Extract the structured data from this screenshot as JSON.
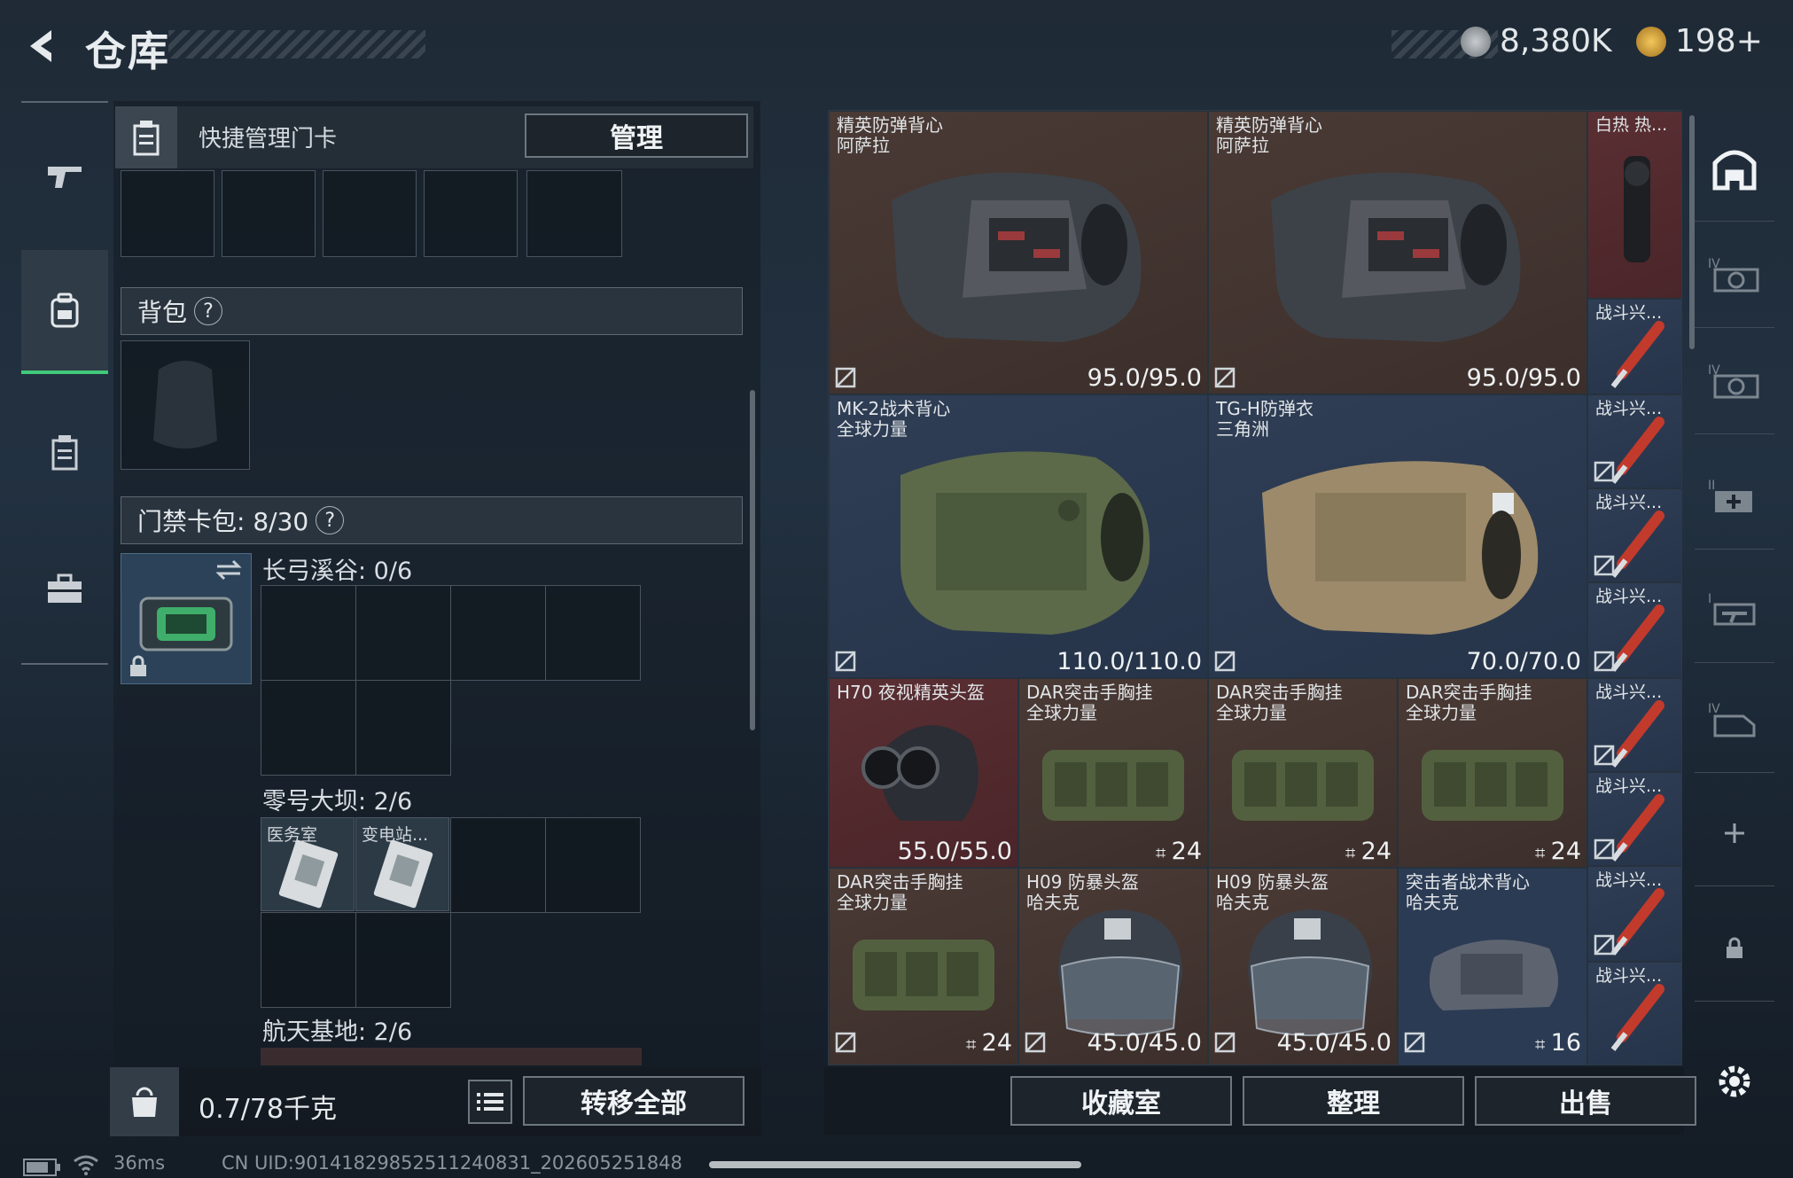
{
  "header": {
    "title": "仓库",
    "currency1": "8,380K",
    "currency2": "198+"
  },
  "nav": {
    "items": [
      {
        "name": "weapon"
      },
      {
        "name": "backpack",
        "active": true
      },
      {
        "name": "keycard"
      },
      {
        "name": "case"
      }
    ]
  },
  "quick": {
    "label": "快捷管理门卡",
    "manage_label": "管理"
  },
  "backpack": {
    "label": "背包",
    "help": "?"
  },
  "keycard_pack": {
    "label": "门禁卡包: 8/30",
    "help": "?"
  },
  "maps": [
    {
      "label": "长弓溪谷: 0/6"
    },
    {
      "label": "零号大坝: 2/6",
      "cards": [
        "医务室",
        "变电站..."
      ]
    },
    {
      "label": "航天基地: 2/6"
    }
  ],
  "bottom_left": {
    "weight": "0.7/78千克",
    "transfer_label": "转移全部"
  },
  "items": [
    {
      "name": "精英防弹背心\n阿萨拉",
      "value": "95.0/95.0"
    },
    {
      "name": "精英防弹背心\n阿萨拉",
      "value": "95.0/95.0"
    },
    {
      "name": "白热 热...",
      "value": ""
    },
    {
      "name": "MK-2战术背心\n全球力量",
      "value": "110.0/110.0"
    },
    {
      "name": "TG-H防弹衣\n三角洲",
      "value": "70.0/70.0"
    },
    {
      "name": "H70 夜视精英头盔",
      "value": "55.0/55.0"
    },
    {
      "name": "DAR突击手胸挂\n全球力量",
      "value": "24"
    },
    {
      "name": "DAR突击手胸挂\n全球力量",
      "value": "24"
    },
    {
      "name": "DAR突击手胸挂\n全球力量",
      "value": "24"
    },
    {
      "name": "DAR突击手胸挂\n全球力量",
      "value": "24"
    },
    {
      "name": "H09 防暴头盔\n哈夫克",
      "value": "45.0/45.0"
    },
    {
      "name": "H09 防暴头盔\n哈夫克",
      "value": "45.0/45.0"
    },
    {
      "name": "突击者战术背心\n哈夫克",
      "value": "16"
    }
  ],
  "flares": {
    "label": "战斗兴..."
  },
  "actions": {
    "collection": "收藏室",
    "sort": "整理",
    "sell": "出售"
  },
  "status": {
    "ping": "36ms",
    "uid": "CN UID:901418298525112408​31_202605251848"
  }
}
